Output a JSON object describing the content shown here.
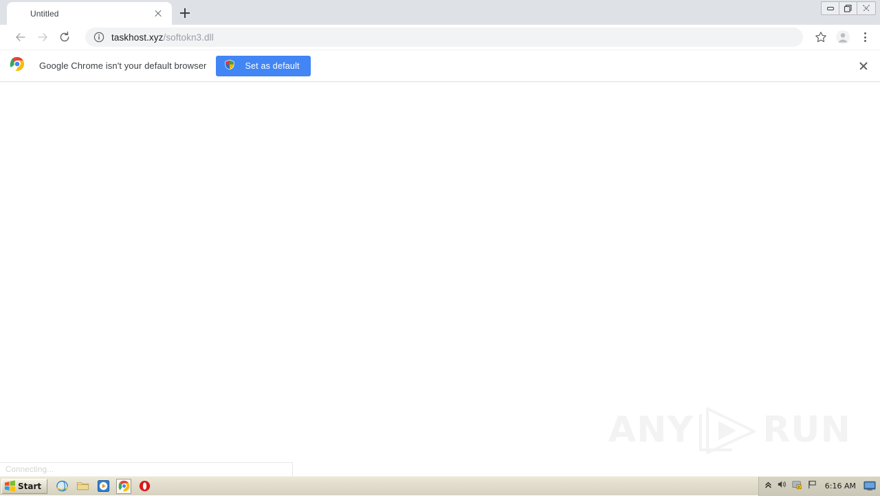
{
  "window": {
    "controls": [
      {
        "name": "minimize",
        "glyph": "—"
      },
      {
        "name": "restore",
        "glyph": "❐"
      },
      {
        "name": "close",
        "glyph": "✕"
      }
    ]
  },
  "tabstrip": {
    "tabs": [
      {
        "title": "Untitled",
        "close_icon": "close-icon"
      }
    ],
    "new_tab_label": "+"
  },
  "toolbar": {
    "back_icon": "back-arrow-icon",
    "forward_icon": "forward-arrow-icon",
    "reload_icon": "reload-icon",
    "security_icon": "info-circle-icon",
    "url_domain": "taskhost.xyz",
    "url_path": "/softokn3.dll",
    "url_full": "taskhost.xyz/softokn3.dll",
    "bookmark_icon": "star-icon",
    "profile_icon": "avatar-icon",
    "menu_icon": "three-dot-menu-icon"
  },
  "infobar": {
    "brand_icon": "chrome-logo-icon",
    "message": "Google Chrome isn't your default browser",
    "button_label": "Set as default",
    "button_icon": "uac-shield-icon",
    "button_color": "#4285f4",
    "close_icon": "close-icon"
  },
  "page": {
    "status_text": "Connecting...",
    "watermark": {
      "left_text": "ANY",
      "right_text": "RUN",
      "logo": "play-triangle-icon"
    }
  },
  "taskbar": {
    "start_label": "Start",
    "quick_launch": [
      {
        "name": "internet-explorer",
        "active": false
      },
      {
        "name": "windows-explorer",
        "active": false
      },
      {
        "name": "media-player",
        "active": false
      },
      {
        "name": "google-chrome",
        "active": true
      },
      {
        "name": "opera-browser",
        "active": false
      }
    ],
    "tray": {
      "chevron_icon": "show-hidden-icons-icon",
      "volume_icon": "volume-icon",
      "security_icon": "security-alert-icon",
      "flag_icon": "action-center-flag-icon",
      "clock": "6:16 AM",
      "show_desktop_icon": "show-desktop-icon"
    }
  }
}
